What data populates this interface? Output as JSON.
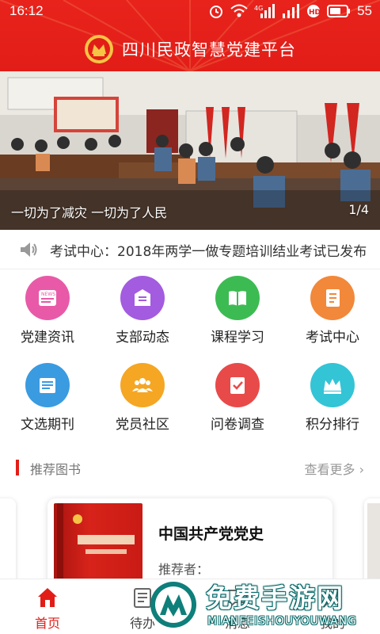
{
  "status_bar": {
    "time": "16:12",
    "battery": "55",
    "network_label": "4G"
  },
  "header": {
    "title": "四川民政智慧党建平台"
  },
  "banner": {
    "caption": "一切为了减灾 一切为了人民",
    "pager": "1/4"
  },
  "notice": {
    "text": "考试中心：2018年两学一做专题培训结业考试已发布"
  },
  "menu": [
    {
      "label": "党建资讯",
      "icon": "news-icon",
      "color": "#e85aa8"
    },
    {
      "label": "支部动态",
      "icon": "notice-icon",
      "color": "#a35be0"
    },
    {
      "label": "课程学习",
      "icon": "book-icon",
      "color": "#3dbb53"
    },
    {
      "label": "考试中心",
      "icon": "exam-icon",
      "color": "#f2883a"
    },
    {
      "label": "文选期刊",
      "icon": "journal-icon",
      "color": "#3a9be0"
    },
    {
      "label": "党员社区",
      "icon": "community-icon",
      "color": "#f5a623"
    },
    {
      "label": "问卷调查",
      "icon": "survey-icon",
      "color": "#e84a4a"
    },
    {
      "label": "积分排行",
      "icon": "ranking-icon",
      "color": "#33c4d6"
    }
  ],
  "recommend": {
    "title": "推荐图书",
    "more": "查看更多",
    "book_title": "中国共产党党史",
    "recommender_label": "推荐者："
  },
  "tabs": [
    {
      "label": "首页",
      "icon": "home-icon"
    },
    {
      "label": "待办",
      "icon": "todo-icon"
    },
    {
      "label": "消息",
      "icon": "message-icon"
    },
    {
      "label": "我的",
      "icon": "user-icon"
    }
  ],
  "watermark": {
    "cn": "免费手游网",
    "en": "MIANFEISHOUYOUWANG"
  },
  "colors": {
    "brand_red": "#e21d18",
    "text": "#222222"
  }
}
